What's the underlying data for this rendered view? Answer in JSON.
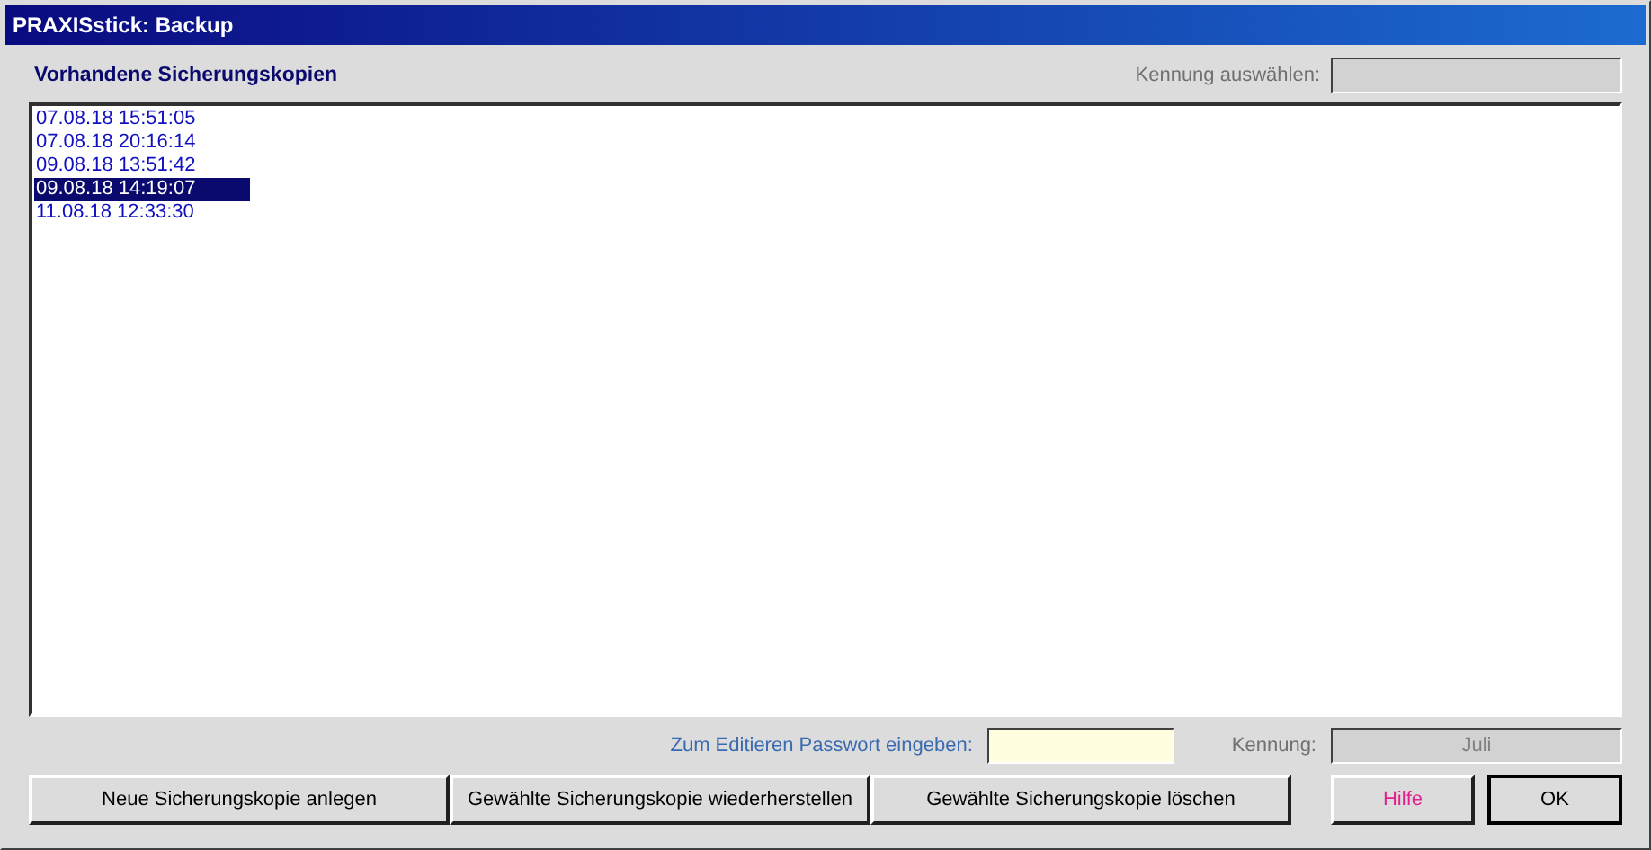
{
  "window": {
    "title": "PRAXISstick: Backup"
  },
  "list": {
    "heading": "Vorhandene Sicherungskopien",
    "items": [
      {
        "label": "07.08.18 15:51:05",
        "selected": false
      },
      {
        "label": "07.08.18 20:16:14",
        "selected": false
      },
      {
        "label": "09.08.18 13:51:42",
        "selected": false
      },
      {
        "label": "09.08.18 14:19:07",
        "selected": true
      },
      {
        "label": "11.08.18 12:33:30",
        "selected": false
      }
    ]
  },
  "id_select": {
    "label": "Kennung auswählen:",
    "disabled": true
  },
  "password": {
    "label": "Zum Editieren Passwort eingeben:"
  },
  "id_field": {
    "label": "Kennung:",
    "value": "Juli",
    "disabled": true
  },
  "buttons": [
    {
      "label": "Neue Sicherungskopie anlegen",
      "kind": "action"
    },
    {
      "label": "Gewählte Sicherungskopie wiederherstellen",
      "kind": "action"
    },
    {
      "label": "Gewählte Sicherungskopie löschen",
      "kind": "action"
    },
    {
      "label": "Hilfe",
      "kind": "help"
    },
    {
      "label": "OK",
      "kind": "default"
    }
  ]
}
